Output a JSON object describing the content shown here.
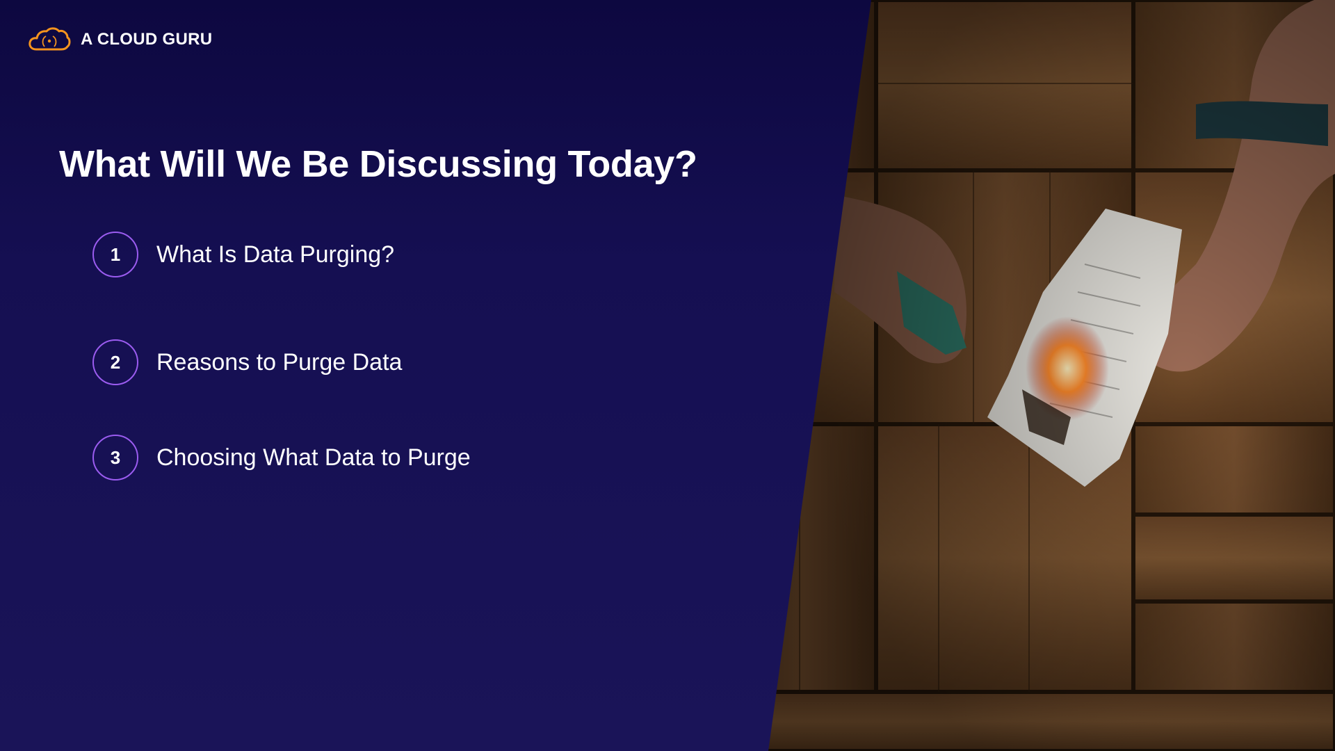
{
  "brand": {
    "name": "A CLOUD GURU",
    "logo_icon": "cloud-logo-icon",
    "accent_color": "#f5941e"
  },
  "slide": {
    "title": "What Will We Be Discussing Today?",
    "agenda": [
      {
        "number": "1",
        "label": "What Is Data Purging?"
      },
      {
        "number": "2",
        "label": "Reasons to Purge Data"
      },
      {
        "number": "3",
        "label": "Choosing What Data to Purge"
      }
    ],
    "circle_color": "#9b5cf0",
    "background_color": "#15104d",
    "photo_icon": "burning-receipt-photo"
  }
}
